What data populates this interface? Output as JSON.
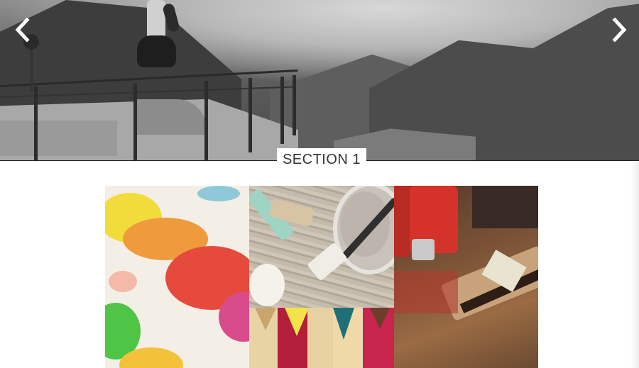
{
  "slider": {
    "prev_icon": "chevron-left-icon",
    "next_icon": "chevron-right-icon",
    "arrow_color": "#ffffff"
  },
  "section": {
    "label": "SECTION 1"
  },
  "gallery": {
    "tiles": [
      {
        "name": "watercolor-paints"
      },
      {
        "name": "paint-brushes-and-can"
      },
      {
        "name": "colored-pencils"
      },
      {
        "name": "oil-paint-tubes-and-brushes"
      }
    ]
  }
}
